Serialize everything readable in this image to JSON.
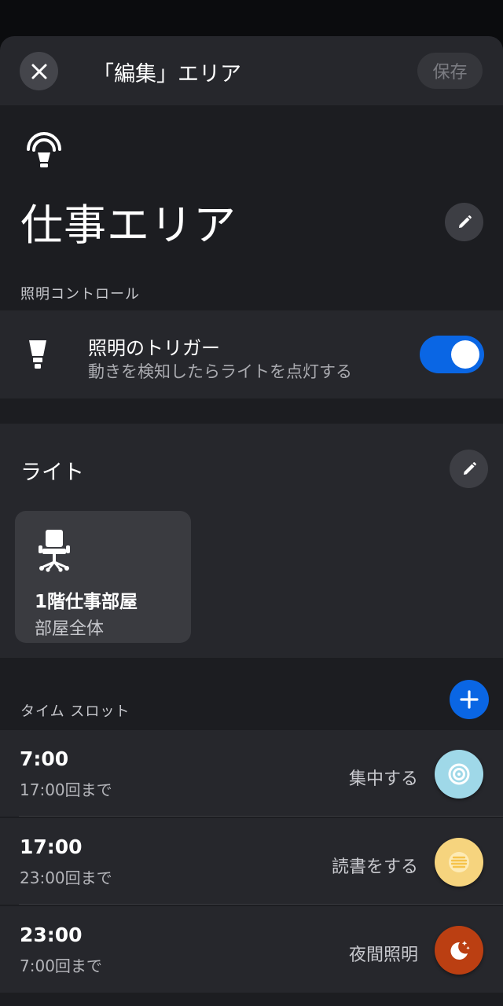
{
  "header": {
    "title": "「編集」エリア",
    "save_label": "保存"
  },
  "area": {
    "name": "仕事エリア",
    "icon": "area-sensor-icon"
  },
  "lighting_control": {
    "section_label": "照明コントロール",
    "trigger_title": "照明のトリガー",
    "trigger_subtitle": "動きを検知したらライトを点灯する",
    "trigger_enabled": true
  },
  "lights": {
    "title": "ライト",
    "rooms": [
      {
        "name": "1階仕事部屋",
        "subtitle": "部屋全体",
        "icon": "office-chair-icon"
      }
    ]
  },
  "time_slots": {
    "section_label": "タイム スロット",
    "items": [
      {
        "time": "7:00",
        "until": "17:00回まで",
        "scene": "集中する",
        "icon": "concentric-circles-icon",
        "color": "#9fd8e8"
      },
      {
        "time": "17:00",
        "until": "23:00回まで",
        "scene": "読書をする",
        "icon": "lines-icon",
        "color": "#f6d47e"
      },
      {
        "time": "23:00",
        "until": "7:00回まで",
        "scene": "夜間照明",
        "icon": "moon-stars-icon",
        "color": "#bb3f12"
      }
    ]
  },
  "colors": {
    "accent": "#0a66e4",
    "background": "#1c1d21",
    "card": "#26272c"
  }
}
